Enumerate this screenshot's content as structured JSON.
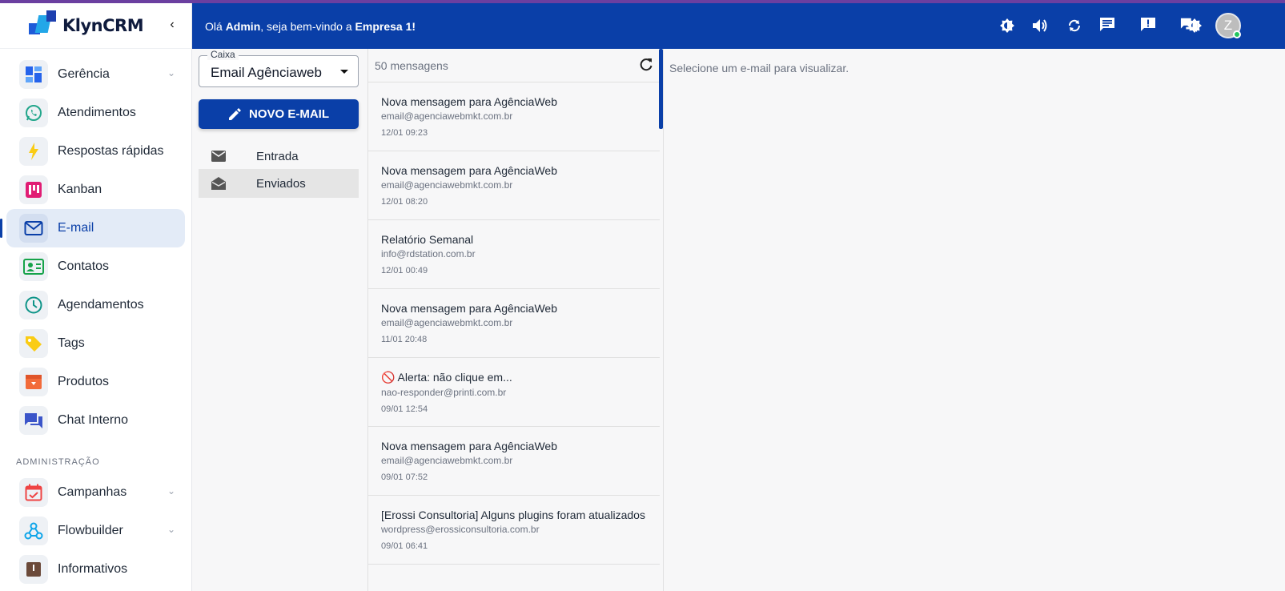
{
  "app": {
    "logo_text": "KlynCRM"
  },
  "sidebar": {
    "items": [
      {
        "label": "Gerência",
        "icon": "dashboard-icon",
        "has_chevron": true
      },
      {
        "label": "Atendimentos",
        "icon": "whatsapp-icon"
      },
      {
        "label": "Respostas rápidas",
        "icon": "bolt-icon"
      },
      {
        "label": "Kanban",
        "icon": "kanban-icon"
      },
      {
        "label": "E-mail",
        "icon": "mail-icon",
        "active": true
      },
      {
        "label": "Contatos",
        "icon": "contact-card-icon"
      },
      {
        "label": "Agendamentos",
        "icon": "clock-icon"
      },
      {
        "label": "Tags",
        "icon": "tag-icon"
      },
      {
        "label": "Produtos",
        "icon": "product-box-icon"
      },
      {
        "label": "Chat Interno",
        "icon": "chat-icon"
      }
    ],
    "admin_section_title": "ADMINISTRAÇÃO",
    "admin_items": [
      {
        "label": "Campanhas",
        "icon": "calendar-check-icon",
        "has_chevron": true
      },
      {
        "label": "Flowbuilder",
        "icon": "webhook-icon",
        "has_chevron": true
      },
      {
        "label": "Informativos",
        "icon": "info-icon"
      }
    ]
  },
  "header": {
    "greeting_prefix": "Olá ",
    "user": "Admin",
    "greeting_middle": ", seja bem-vindo a ",
    "company": "Empresa 1",
    "greeting_suffix": "!",
    "avatar_letter": "Z",
    "icons": [
      "brightness-icon",
      "volume-icon",
      "refresh-icon",
      "message-icon",
      "alert-message-icon",
      "forum-icon"
    ]
  },
  "email": {
    "mailbox_label": "Caixa",
    "mailbox_value": "Email Agênciaweb",
    "compose_label": "NOVO E-MAIL",
    "folders": [
      {
        "label": "Entrada",
        "icon": "inbox-mail-icon"
      },
      {
        "label": "Enviados",
        "icon": "open-mail-icon",
        "selected": true
      }
    ],
    "count_label": "50 mensagens",
    "messages": [
      {
        "subject": "Nova mensagem para AgênciaWeb",
        "from": "email@agenciawebmkt.com.br",
        "date": "12/01 09:23"
      },
      {
        "subject": "Nova mensagem para AgênciaWeb",
        "from": "email@agenciawebmkt.com.br",
        "date": "12/01 08:20"
      },
      {
        "subject": "Relatório Semanal",
        "from": "info@rdstation.com.br",
        "date": "12/01 00:49"
      },
      {
        "subject": "Nova mensagem para AgênciaWeb",
        "from": "email@agenciawebmkt.com.br",
        "date": "11/01 20:48"
      },
      {
        "subject": "🚫 Alerta: não clique em...",
        "from": "nao-responder@printi.com.br",
        "date": "09/01 12:54"
      },
      {
        "subject": "Nova mensagem para AgênciaWeb",
        "from": "email@agenciawebmkt.com.br",
        "date": "09/01 07:52"
      },
      {
        "subject": "[Erossi Consultoria] Alguns plugins foram atualizados",
        "from": "wordpress@erossiconsultoria.com.br",
        "date": "09/01 06:41"
      }
    ],
    "viewer_placeholder": "Selecione um e-mail para visualizar."
  },
  "colors": {
    "primary": "#0a3fa8",
    "top_strip": "#6b3fa0",
    "online": "#22c55e"
  }
}
